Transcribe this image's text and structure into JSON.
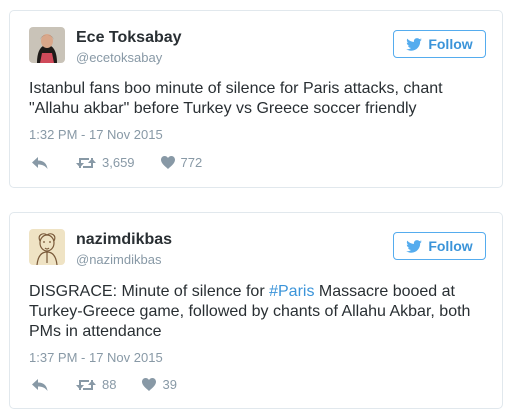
{
  "tweets": [
    {
      "name": "Ece Toksabay",
      "handle": "@ecetoksabay",
      "follow_label": "Follow",
      "text": "Istanbul fans boo minute of silence for Paris attacks, chant \"Allahu akbar\" before Turkey vs Greece soccer friendly",
      "timestamp": "1:32 PM - 17 Nov 2015",
      "retweets": "3,659",
      "likes": "772"
    },
    {
      "name": "nazimdikbas",
      "handle": "@nazimdikbas",
      "follow_label": "Follow",
      "text_before": "DISGRACE: Minute of silence for ",
      "hashtag": "#Paris",
      "text_after": " Massacre booed at Turkey-Greece game, followed by chants of Allahu Akbar, both PMs in attendance",
      "timestamp": "1:37 PM - 17 Nov 2015",
      "retweets": "88",
      "likes": "39"
    }
  ],
  "icons": {
    "bird": "twitter-bird-icon",
    "reply": "reply-icon",
    "retweet": "retweet-icon",
    "like": "heart-icon"
  },
  "colors": {
    "accent": "#55acee",
    "link": "#3b94d9",
    "muted": "#8899a6",
    "text": "#292f33",
    "border": "#e1e8ed"
  }
}
